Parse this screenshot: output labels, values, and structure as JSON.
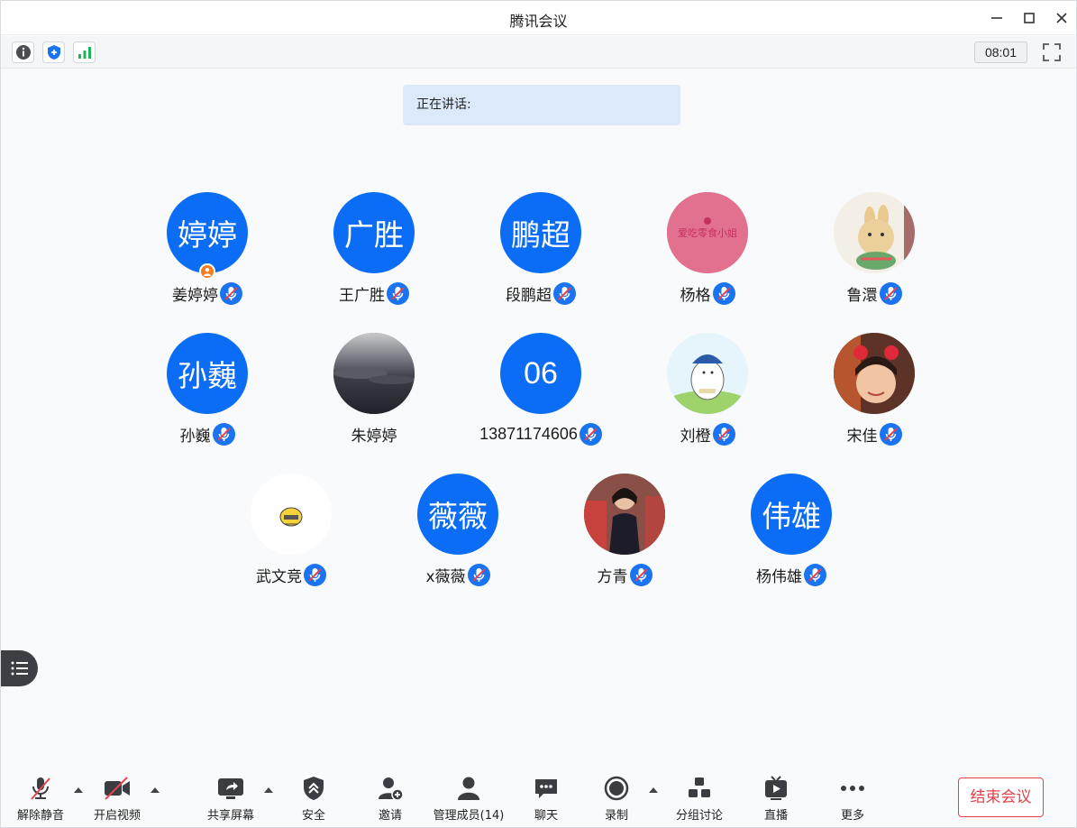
{
  "window": {
    "title": "腾讯会议"
  },
  "infobar": {
    "timer": "08:01"
  },
  "speaking": {
    "label": "正在讲话:"
  },
  "colors": {
    "accent": "#0b6cf5",
    "end": "#e2434a",
    "host": "#f57c1f"
  },
  "participants": [
    {
      "name": "姜婷婷",
      "avatar_text": "婷婷",
      "avatar_type": "text",
      "host": true,
      "mic": "muted"
    },
    {
      "name": "王广胜",
      "avatar_text": "广胜",
      "avatar_type": "text",
      "mic": "muted"
    },
    {
      "name": "段鹏超",
      "avatar_text": "鹏超",
      "avatar_type": "text",
      "mic": "muted"
    },
    {
      "name": "杨格",
      "avatar_type": "photo",
      "photo": "pink-text",
      "photo_caption": "爱吃零食小姐",
      "mic": "muted"
    },
    {
      "name": "鲁澴",
      "avatar_type": "photo",
      "photo": "cartoon-rabbit",
      "mic": "muted"
    },
    {
      "name": "孙巍",
      "avatar_text": "孙巍",
      "avatar_type": "text",
      "mic": "muted"
    },
    {
      "name": "朱婷婷",
      "avatar_type": "photo",
      "photo": "cloud-sky",
      "mic": "none"
    },
    {
      "name": "13871174606",
      "avatar_text": "06",
      "avatar_type": "text",
      "mic": "muted"
    },
    {
      "name": "刘橙",
      "avatar_type": "photo",
      "photo": "penguin-cartoon",
      "mic": "muted"
    },
    {
      "name": "宋佳",
      "avatar_type": "photo",
      "photo": "child-photo",
      "mic": "muted"
    },
    {
      "name": "武文竞",
      "avatar_type": "photo",
      "photo": "yellow-chick",
      "mic": "muted"
    },
    {
      "name": "x薇薇",
      "avatar_text": "薇薇",
      "avatar_type": "text",
      "mic": "muted"
    },
    {
      "name": "方青",
      "avatar_type": "photo",
      "photo": "person-photo",
      "mic": "muted"
    },
    {
      "name": "杨伟雄",
      "avatar_text": "伟雄",
      "avatar_type": "text",
      "mic": "muted"
    }
  ],
  "toolbar": {
    "unmute": "解除静音",
    "start_video": "开启视频",
    "share_screen": "共享屏幕",
    "security": "安全",
    "invite": "邀请",
    "manage_members": "管理成员(14)",
    "chat": "聊天",
    "record": "录制",
    "breakout": "分组讨论",
    "live": "直播",
    "more": "更多",
    "end_meeting": "结束会议"
  }
}
